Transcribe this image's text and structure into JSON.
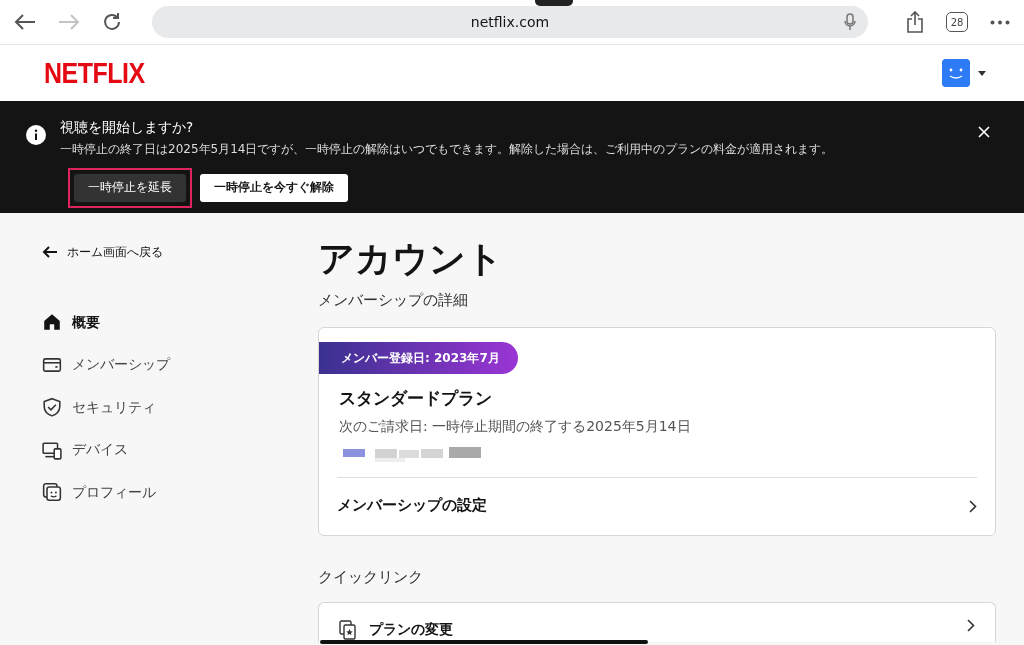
{
  "browser": {
    "url": "netflix.com",
    "tab_count": "28",
    "forward_disabled": true
  },
  "header": {
    "logo": "NETFLIX"
  },
  "banner": {
    "title": "視聴を開始しますか?",
    "message": "一時停止の終了日は2025年5月14日ですが、一時停止の解除はいつでもできます。解除した場合は、ご利用中のプランの料金が適用されます。",
    "buttons": [
      {
        "label": "一時停止を延長",
        "kind": "dark",
        "highlighted": true
      },
      {
        "label": "一時停止を今すぐ解除",
        "kind": "light",
        "highlighted": false
      }
    ]
  },
  "sidebar": {
    "back": "ホーム画面へ戻る",
    "items": [
      {
        "label": "概要",
        "kind": "home",
        "selected": true
      },
      {
        "label": "メンバーシップ",
        "kind": "card",
        "selected": false
      },
      {
        "label": "セキュリティ",
        "kind": "shield",
        "selected": false
      },
      {
        "label": "デバイス",
        "kind": "devices",
        "selected": false
      },
      {
        "label": "プロフィール",
        "kind": "profile",
        "selected": false
      }
    ]
  },
  "main": {
    "title": "アカウント",
    "section": "メンバーシップの詳細",
    "membership": {
      "badge": "メンバー登録日: 2023年7月",
      "plan": "スタンダードプラン",
      "billing": "次のご請求日: 一時停止期間の終了する2025年5月14日",
      "settings": "メンバーシップの設定"
    },
    "quick_links_heading": "クイックリンク",
    "quick_links": [
      {
        "label": "プランの変更"
      }
    ]
  }
}
